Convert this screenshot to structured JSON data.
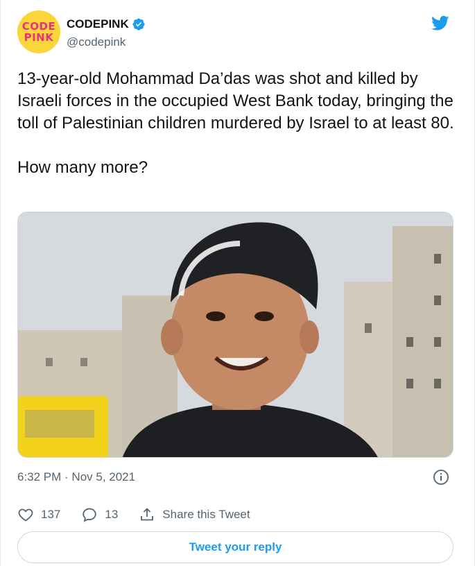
{
  "author": {
    "avatar_text_line1": "CODE",
    "avatar_text_line2": "PINK",
    "display_name": "CODEPINK",
    "handle": "@codepink",
    "verified": true
  },
  "tweet": {
    "text": "13-year-old Mohammad Da’das was shot and killed by Israeli forces in the occupied West Bank today, bringing the toll of Palestinian children murdered by Israel to at least 80.\n\nHow many more?",
    "timestamp": "6:32 PM · Nov 5, 2021"
  },
  "stats": {
    "likes": "137",
    "replies": "13",
    "share_label": "Share this Tweet"
  },
  "reply_button_label": "Tweet your reply",
  "colors": {
    "accent": "#1d9bf0",
    "secondary_text": "#536471",
    "avatar_bg": "#fbd63a",
    "avatar_text": "#e7327e"
  },
  "icons": {
    "platform": "twitter-bird-icon",
    "verified": "verified-badge-icon",
    "info": "info-icon",
    "like": "heart-icon",
    "reply": "comment-icon",
    "share": "share-icon"
  }
}
